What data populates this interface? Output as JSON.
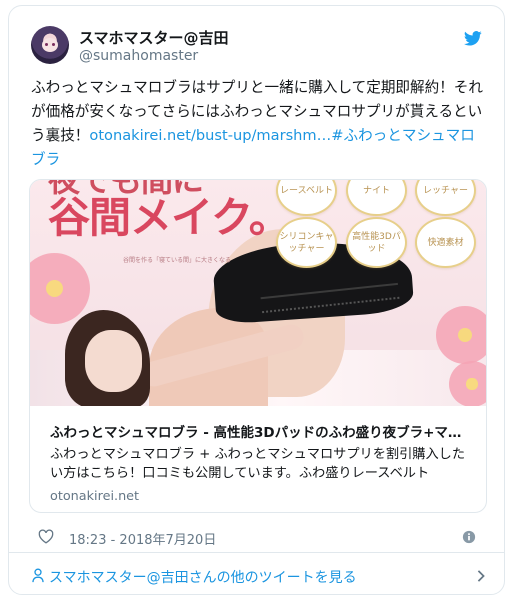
{
  "author": {
    "display_name": "スマホマスター@吉田",
    "handle": "@sumahomaster"
  },
  "tweet": {
    "text_prefix": "ふわっとマシュマロブラはサプリと一緒に購入して定期即解約！それが価格が安くなってさらにはふわっとマシュマロサプリが貰えるという裏技！",
    "link_text": "otonakirei.net/bust-up/marshm…",
    "hashtag_text": "#ふわっとマシュマロブラ",
    "timestamp": "18:23 - 2018年7月20日"
  },
  "media": {
    "headline_line1": "夜でも間に",
    "headline_line2": "谷間メイク。",
    "subcopy": "谷間を作る「寝ている間」に大きくなる",
    "badges": [
      "レースベルト",
      "ナイト",
      "レッチャー",
      "シリコンキャッチャー",
      "高性能3Dパッド",
      "快適素材"
    ]
  },
  "card": {
    "title": "ふわっとマシュマロブラ - 高性能3Dパッドのふわ盛り夜ブラ+マ…",
    "description": "ふわっとマシュマロブラ + ふわっとマシュマロサプリを割引購入したい方はこちら！口コミも公開しています。ふわ盛りレースベルト",
    "domain": "otonakirei.net"
  },
  "footer": {
    "more_tweets": "スマホマスター@吉田さんの他のツイートを見る"
  },
  "colors": {
    "brand_blue": "#1b95e0",
    "text": "#14171a",
    "secondary_text": "#657786",
    "border": "#e1e8ed",
    "headline_pink": "#d9475f"
  },
  "icons": {
    "bird": "twitter-bird-icon",
    "heart": "heart-icon",
    "info": "info-icon",
    "person": "person-icon",
    "chevron": "chevron-right-icon"
  }
}
